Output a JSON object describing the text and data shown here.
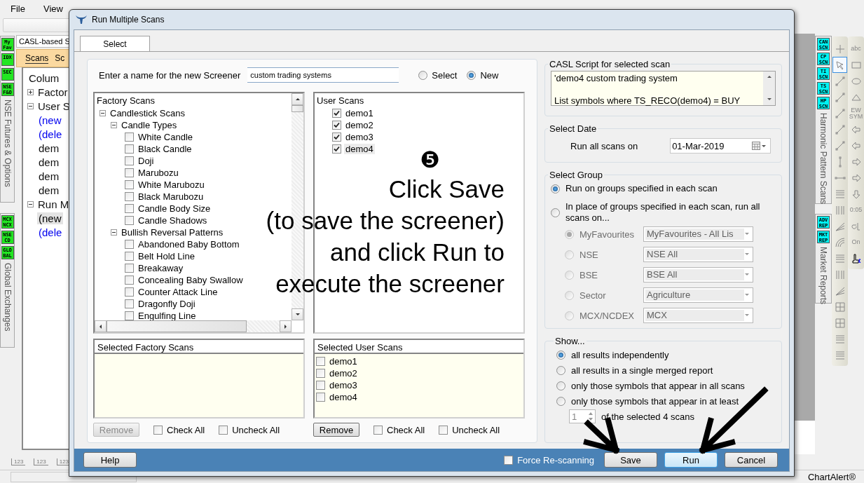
{
  "menu": [
    "File",
    "View"
  ],
  "left_tabs": [
    {
      "badges": [
        "My Fav",
        "IDX",
        "SEC",
        "NSE F&O"
      ],
      "label": "NSE Futures & Options"
    },
    {
      "badges": [
        "MCX NCX",
        "NSE CD",
        "GLO BAL"
      ],
      "label": "Global Exchanges"
    }
  ],
  "side_panel": {
    "title": "CASL-based S",
    "tabs": [
      {
        "label": "Scans",
        "selected": true
      },
      {
        "label": "Sc",
        "selected": false
      }
    ],
    "tree": [
      {
        "label": "Colum",
        "kind": "item",
        "selected": false
      },
      {
        "label": "Factor",
        "kind": "item",
        "selected": false,
        "expanded": false
      },
      {
        "label": "User S",
        "kind": "item",
        "selected": false,
        "expanded": true,
        "children": [
          {
            "label": "(new",
            "kind": "action",
            "selected": false
          },
          {
            "label": "(dele",
            "kind": "action",
            "selected": false
          },
          {
            "label": "dem",
            "kind": "item",
            "selected": false
          },
          {
            "label": "dem",
            "kind": "item",
            "selected": false
          },
          {
            "label": "dem",
            "kind": "item",
            "selected": false
          },
          {
            "label": "dem",
            "kind": "item",
            "selected": false
          }
        ]
      },
      {
        "label": "Run M",
        "kind": "item",
        "selected": false,
        "expanded": true,
        "children": [
          {
            "label": "(new",
            "kind": "action",
            "selected": true
          },
          {
            "label": "(dele",
            "kind": "action",
            "selected": false
          }
        ]
      }
    ]
  },
  "axis_tools": [
    "123",
    "123",
    "123"
  ],
  "dialog": {
    "title": "Run Multiple Scans",
    "tabs": [
      {
        "label": "Select",
        "selected": true
      }
    ],
    "name_label": "Enter a name for the new Screener",
    "name_value": "custom trading systems",
    "mode_options": [
      {
        "label": "Select",
        "selected": false
      },
      {
        "label": "New",
        "selected": true
      }
    ],
    "factory_scans": {
      "title": "Factory Scans",
      "tree": [
        {
          "label": "Candlestick Scans",
          "expanded": true,
          "children": [
            {
              "label": "Candle Types",
              "expanded": true,
              "children": [
                {
                  "label": "White Candle",
                  "checked": false
                },
                {
                  "label": "Black Candle",
                  "checked": false
                },
                {
                  "label": "Doji",
                  "checked": false
                },
                {
                  "label": "Marubozu",
                  "checked": false
                },
                {
                  "label": "White Marubozu",
                  "checked": false
                },
                {
                  "label": "Black Marubozu",
                  "checked": false
                },
                {
                  "label": "Candle Body Size",
                  "checked": false
                },
                {
                  "label": "Candle Shadows",
                  "checked": false
                }
              ]
            },
            {
              "label": "Bullish Reversal Patterns",
              "expanded": true,
              "children": [
                {
                  "label": "Abandoned Baby Bottom",
                  "checked": false
                },
                {
                  "label": "Belt Hold Line",
                  "checked": false
                },
                {
                  "label": "Breakaway",
                  "checked": false
                },
                {
                  "label": "Concealing Baby Swallow",
                  "checked": false
                },
                {
                  "label": "Counter Attack Line",
                  "checked": false
                },
                {
                  "label": "Dragonfly Doji",
                  "checked": false
                },
                {
                  "label": "Engulfing Line",
                  "checked": false
                }
              ]
            }
          ]
        }
      ]
    },
    "user_scans": {
      "title": "User Scans",
      "items": [
        {
          "label": "demo1",
          "checked": true,
          "selected": false
        },
        {
          "label": "demo2",
          "checked": true,
          "selected": false
        },
        {
          "label": "demo3",
          "checked": true,
          "selected": false
        },
        {
          "label": "demo4",
          "checked": true,
          "selected": true
        }
      ]
    },
    "selected_factory": {
      "title": "Selected Factory Scans",
      "remove": {
        "label": "Remove",
        "disabled": true
      },
      "check_all": {
        "label": "Check All",
        "checked": false
      },
      "uncheck_all": {
        "label": "Uncheck All",
        "checked": false
      }
    },
    "selected_user": {
      "title": "Selected User Scans",
      "items": [
        {
          "label": "demo1",
          "checked": false
        },
        {
          "label": "demo2",
          "checked": false
        },
        {
          "label": "demo3",
          "checked": false
        },
        {
          "label": "demo4",
          "checked": false
        }
      ],
      "remove": {
        "label": "Remove",
        "disabled": false
      },
      "check_all": {
        "label": "Check All",
        "checked": false
      },
      "uncheck_all": {
        "label": "Uncheck All",
        "checked": false
      }
    },
    "script_group": {
      "title": "CASL Script for selected scan",
      "script": "'demo4 custom trading system\n\nList symbols where TS_RECO(demo4) = BUY"
    },
    "date_group": {
      "title": "Select Date",
      "label": "Run all scans on",
      "value": "01-Mar-2019"
    },
    "group_select": {
      "title": "Select Group",
      "options": [
        {
          "label": "Run on groups specified in each scan",
          "selected": true
        },
        {
          "label": "In place of groups specified in each scan, run all scans on...",
          "selected": false
        }
      ],
      "sub_options": [
        {
          "label": "MyFavourites",
          "value": "MyFavourites - All Lis",
          "selected": true,
          "disabled": true
        },
        {
          "label": "NSE",
          "value": "NSE All",
          "selected": false,
          "disabled": true
        },
        {
          "label": "BSE",
          "value": "BSE All",
          "selected": false,
          "disabled": true
        },
        {
          "label": "Sector",
          "value": "Agriculture",
          "selected": false,
          "disabled": true
        },
        {
          "label": "MCX/NCDEX",
          "value": "MCX",
          "selected": false,
          "disabled": true
        }
      ]
    },
    "show_group": {
      "title": "Show...",
      "options": [
        {
          "label": "all results independently",
          "selected": true
        },
        {
          "label": "all results in a single merged report",
          "selected": false
        },
        {
          "label": "only those symbols that appear in all scans",
          "selected": false
        },
        {
          "label": "only those symbols that appear in at least",
          "selected": false
        }
      ],
      "count": "1",
      "count_suffix": "of the selected 4 scans"
    },
    "footer": {
      "help": {
        "label": "Help",
        "focused": false
      },
      "force": {
        "label": "Force Re-scanning",
        "checked": false
      },
      "buttons": [
        {
          "label": "Save",
          "focused": false
        },
        {
          "label": "Run",
          "focused": true
        },
        {
          "label": "Cancel",
          "focused": false
        }
      ]
    },
    "annotation": {
      "marker": "❺",
      "lines": [
        "Click Save",
        "(to save the screener)",
        "and click Run to",
        "execute the screener"
      ]
    }
  },
  "right_tabs": [
    {
      "badges": [
        "CAN SCN",
        "CP SCN",
        "TI SCN",
        "TS SCN",
        "HP SCN"
      ],
      "label": "Harmonic Pattern Scans"
    },
    {
      "badges": [
        "ADV REP",
        "MKT REP"
      ],
      "label": "Market Reports"
    }
  ],
  "tools": {
    "column_1": [
      {
        "kind": "plus",
        "selected": false
      },
      {
        "kind": "pointer",
        "selected": true
      },
      {
        "kind": "line",
        "selected": false
      },
      {
        "kind": "line",
        "selected": false
      },
      {
        "kind": "line",
        "selected": false
      },
      {
        "kind": "line",
        "selected": false
      },
      {
        "kind": "line",
        "selected": false
      },
      {
        "kind": "vline",
        "selected": false
      },
      {
        "kind": "hline",
        "selected": false
      },
      {
        "kind": "levels",
        "selected": false
      },
      {
        "kind": "bars",
        "selected": false
      },
      {
        "kind": "fan",
        "selected": false
      },
      {
        "kind": "arc",
        "selected": false
      },
      {
        "kind": "levels",
        "selected": false
      },
      {
        "kind": "bars",
        "selected": false
      },
      {
        "kind": "fan",
        "selected": false
      },
      {
        "kind": "grid",
        "selected": false
      },
      {
        "kind": "grid",
        "selected": false
      },
      {
        "kind": "levels",
        "selected": false
      },
      {
        "kind": "levels",
        "selected": false
      }
    ],
    "column_2": [
      {
        "kind": "text",
        "label": "abc",
        "selected": false
      },
      {
        "kind": "rect",
        "selected": false
      },
      {
        "kind": "ellipse",
        "selected": false
      },
      {
        "kind": "triangle",
        "selected": false
      },
      {
        "kind": "text",
        "label": "EW SYM",
        "selected": false
      },
      {
        "kind": "arrowl",
        "selected": false
      },
      {
        "kind": "arrowl",
        "selected": false
      },
      {
        "kind": "arrowr",
        "selected": false
      },
      {
        "kind": "arrowr",
        "selected": false
      },
      {
        "kind": "arrowd",
        "selected": false
      },
      {
        "kind": "text",
        "label": "0:05",
        "selected": false
      },
      {
        "kind": "marker",
        "selected": false
      },
      {
        "kind": "text",
        "label": "On",
        "selected": false
      },
      {
        "kind": "cursor",
        "selected": false
      }
    ]
  },
  "status": "ChartAlert®"
}
